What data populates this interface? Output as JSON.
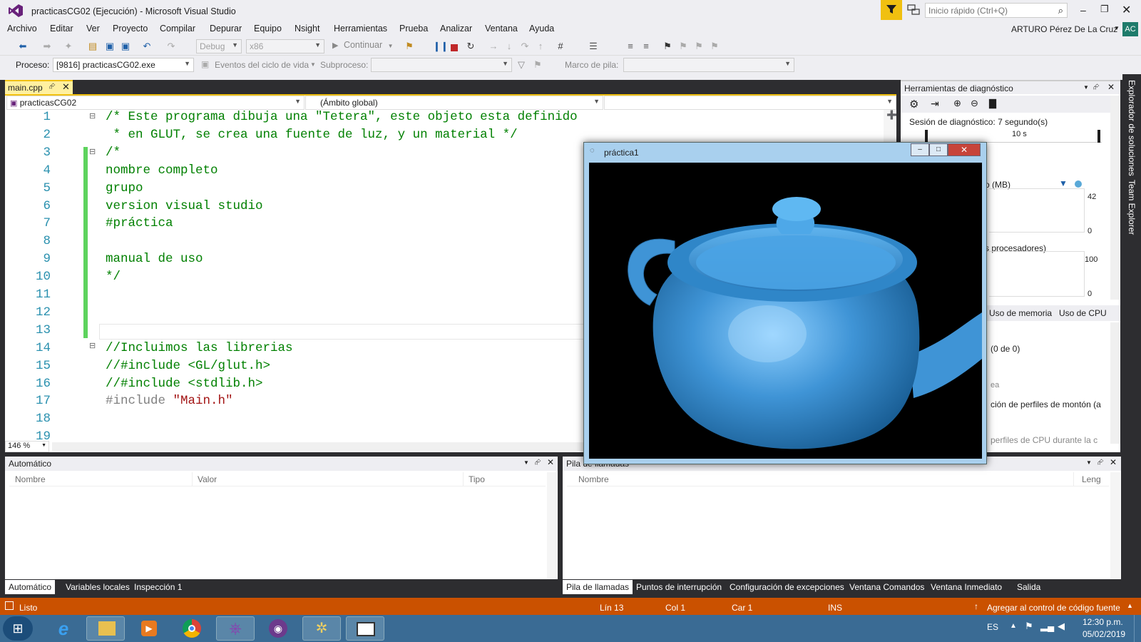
{
  "window": {
    "title": "practicasCG02 (Ejecución) - Microsoft Visual Studio",
    "quick_launch_placeholder": "Inicio rápido (Ctrl+Q)",
    "user": "ARTURO Pérez De La Cruz",
    "user_initials": "AC"
  },
  "menu": [
    "Archivo",
    "Editar",
    "Ver",
    "Proyecto",
    "Compilar",
    "Depurar",
    "Equipo",
    "Nsight",
    "Herramientas",
    "Prueba",
    "Analizar",
    "Ventana",
    "Ayuda"
  ],
  "toolbar": {
    "config": "Debug",
    "platform": "x86",
    "continue_label": "Continuar",
    "process_label": "Proceso:",
    "process_value": "[9816] practicasCG02.exe",
    "lifecycle_label": "Eventos del ciclo de vida",
    "thread_label": "Subproceso:",
    "stack_label": "Marco de pila:"
  },
  "editor": {
    "tab": "main.cpp",
    "project_combo": "practicasCG02",
    "scope_combo": "(Ámbito global)",
    "zoom": "146 %",
    "lines": [
      {
        "n": "1",
        "text": "/* Este programa dibuja una \"Tetera\", este objeto esta definido"
      },
      {
        "n": "2",
        "text": " * en GLUT, se crea una fuente de luz, y un material */"
      },
      {
        "n": "3",
        "text": "/*"
      },
      {
        "n": "4",
        "text": "nombre completo"
      },
      {
        "n": "5",
        "text": "grupo"
      },
      {
        "n": "6",
        "text": "version visual studio"
      },
      {
        "n": "7",
        "text": "#práctica"
      },
      {
        "n": "8",
        "text": ""
      },
      {
        "n": "9",
        "text": "manual de uso"
      },
      {
        "n": "10",
        "text": "*/"
      },
      {
        "n": "11",
        "text": ""
      },
      {
        "n": "12",
        "text": ""
      },
      {
        "n": "13",
        "text": ""
      },
      {
        "n": "14",
        "text": "//Incluimos las librerias"
      },
      {
        "n": "15",
        "text": "//#include <GL/glut.h>"
      },
      {
        "n": "16",
        "text": "//#include <stdlib.h>"
      },
      {
        "n": "17",
        "text": "#include ",
        "string": "\"Main.h\""
      },
      {
        "n": "18",
        "text": ""
      },
      {
        "n": "19",
        "text": ""
      }
    ]
  },
  "diagnostics": {
    "title": "Herramientas de diagnóstico",
    "session": "Sesión de diagnóstico: 7 segundo(s)",
    "time_mark": "10 s",
    "memory_label": "o (MB)",
    "memory_max": "42",
    "memory_min": "0",
    "cpu_label": "s procesadores)",
    "cpu_max": "100",
    "cpu_min": "0",
    "tabs": [
      "Uso de memoria",
      "Uso de CPU"
    ],
    "events_count": "(0 de 0)",
    "item_a": "ea",
    "item_heap": "ción de perfiles de montón (a",
    "item_cpu": "perfiles de CPU durante la c"
  },
  "side_tabs": [
    "Explorador de soluciones",
    "Team Explorer"
  ],
  "auto_panel": {
    "title": "Automático",
    "columns": [
      "Nombre",
      "Valor",
      "Tipo"
    ],
    "tabs": [
      "Automático",
      "Variables locales",
      "Inspección 1"
    ]
  },
  "callstack_panel": {
    "title": "Pila de llamadas",
    "columns": [
      "Nombre",
      "Leng"
    ],
    "tabs": [
      "Pila de llamadas",
      "Puntos de interrupción",
      "Configuración de excepciones",
      "Ventana Comandos",
      "Ventana Inmediato",
      "Salida"
    ]
  },
  "glut_window": {
    "title": "práctica1",
    "teapot_color": "#3f94d6"
  },
  "status": {
    "ready": "Listo",
    "line": "Lín 13",
    "col": "Col 1",
    "car": "Car 1",
    "ins": "INS",
    "source_control": "Agregar al control de código fuente"
  },
  "taskbar": {
    "lang": "ES",
    "time": "12:30 p.m.",
    "date": "05/02/2019"
  },
  "colors": {
    "accent": "#ca5100",
    "vs_purple": "#68217a",
    "status_orange": "#ca5100"
  }
}
